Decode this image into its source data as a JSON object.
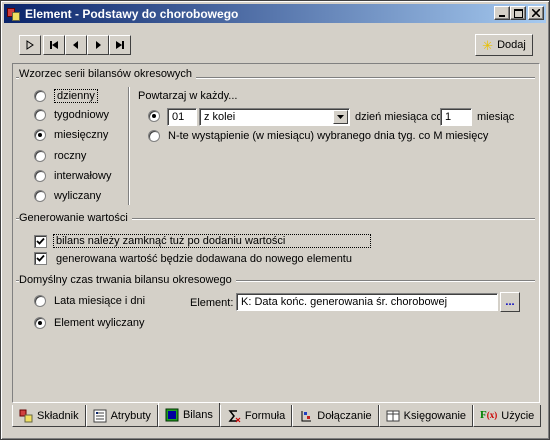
{
  "window": {
    "title": "Element - Podstawy do chorobowego",
    "minimize": "_",
    "maximize": "□",
    "close": "✕"
  },
  "toolbar": {
    "add_label": "Dodaj"
  },
  "series_section": {
    "title": "Wzorzec serii bilansów okresowych",
    "options": [
      "dzienny",
      "tygodniowy",
      "miesięczny",
      "roczny",
      "interwałowy",
      "wyliczany"
    ],
    "selected": "miesięczny",
    "repeat_label": "Powtarzaj w każdy...",
    "day_value": "01",
    "mode_value": "z kolei",
    "day_of_month_label": "dzień miesiąca co",
    "every_value": "1",
    "month_label": "miesiąc",
    "nth_option_label": "N-te wystąpienie (w miesiącu) wybranego dnia tyg. co M miesięcy"
  },
  "generate_section": {
    "title": "Generowanie wartości",
    "close_balance_label": "bilans należy zamknąć tuż po dodaniu wartości",
    "close_balance_checked": true,
    "new_element_label": "generowana wartość będzie dodawana do nowego elementu",
    "new_element_checked": true
  },
  "duration_section": {
    "title": "Domyślny czas trwania bilansu okresowego",
    "option_years": "Lata miesiące i dni",
    "option_computed": "Element wyliczany",
    "selected": "Element wyliczany",
    "element_label": "Element:",
    "element_value": "K: Data końc. generowania śr. chorobowej",
    "browse_label": "..."
  },
  "tabs": [
    {
      "label": "Składnik",
      "icon": "ingredient-icon"
    },
    {
      "label": "Atrybuty",
      "icon": "attributes-icon"
    },
    {
      "label": "Bilans",
      "icon": "balance-icon"
    },
    {
      "label": "Formuła",
      "icon": "formula-icon"
    },
    {
      "label": "Dołączanie",
      "icon": "attach-icon"
    },
    {
      "label": "Księgowanie",
      "icon": "booking-icon"
    },
    {
      "label": "Użycie",
      "icon": "usage-icon"
    }
  ],
  "active_tab": "Bilans",
  "colors": {
    "titlebar_start": "#0a246a",
    "titlebar_end": "#a6caf0",
    "face": "#d4d0c8"
  }
}
